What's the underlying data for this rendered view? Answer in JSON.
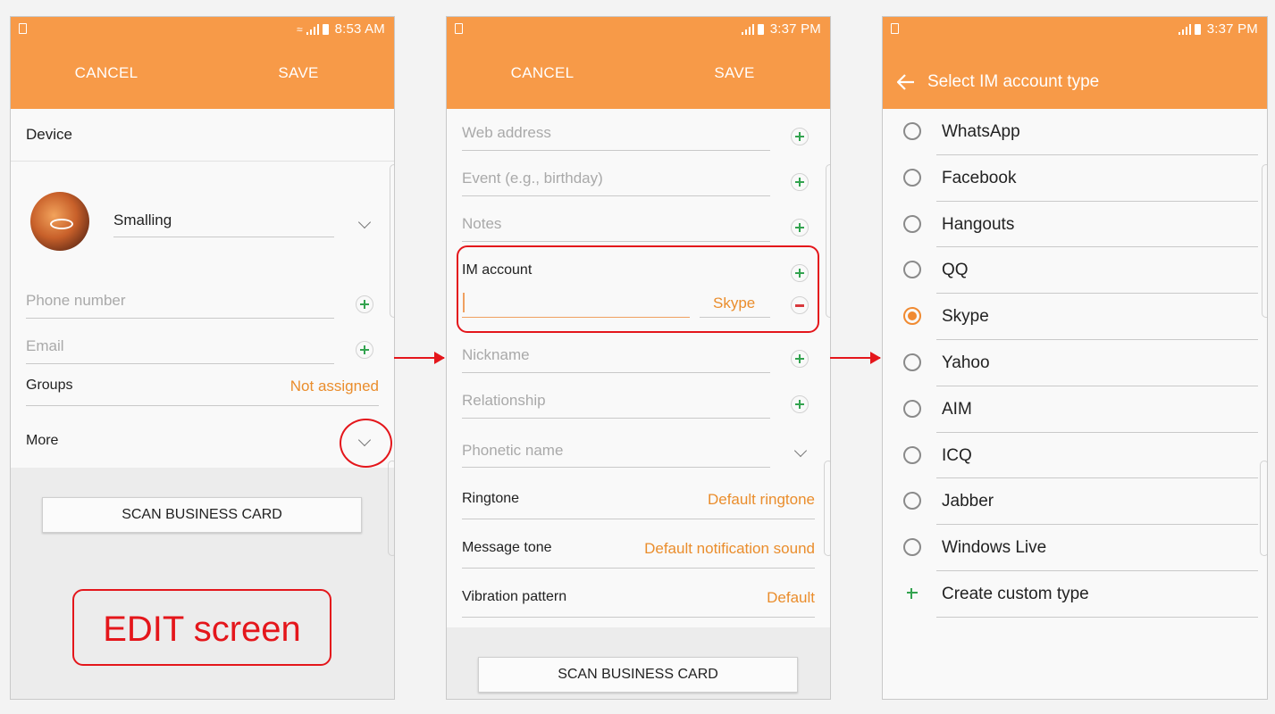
{
  "colors": {
    "accent": "#f79a48",
    "highlight": "#e4161b",
    "add": "#33a34f",
    "remove": "#d8383c",
    "value": "#ea8d2c"
  },
  "panel1": {
    "status_time": "8:53 AM",
    "cancel": "CANCEL",
    "save": "SAVE",
    "device": "Device",
    "contact_name": "Smalling",
    "phone_placeholder": "Phone number",
    "email_placeholder": "Email",
    "groups_label": "Groups",
    "groups_value": "Not assigned",
    "more_label": "More",
    "scan_button": "SCAN BUSINESS CARD",
    "annotation": "EDIT screen"
  },
  "panel2": {
    "status_time": "3:37 PM",
    "cancel": "CANCEL",
    "save": "SAVE",
    "web_placeholder": "Web address",
    "event_placeholder": "Event (e.g., birthday)",
    "notes_placeholder": "Notes",
    "im_label": "IM account",
    "im_type": "Skype",
    "nickname_placeholder": "Nickname",
    "relationship_placeholder": "Relationship",
    "phonetic_placeholder": "Phonetic name",
    "ringtone_label": "Ringtone",
    "ringtone_value": "Default ringtone",
    "message_tone_label": "Message tone",
    "message_tone_value": "Default notification sound",
    "vibration_label": "Vibration pattern",
    "vibration_value": "Default",
    "scan_button": "SCAN BUSINESS CARD"
  },
  "panel3": {
    "status_time": "3:37 PM",
    "title": "Select IM account type",
    "selected": "Skype",
    "options": [
      "WhatsApp",
      "Facebook",
      "Hangouts",
      "QQ",
      "Skype",
      "Yahoo",
      "AIM",
      "ICQ",
      "Jabber",
      "Windows Live"
    ],
    "create_custom": "Create custom type"
  }
}
